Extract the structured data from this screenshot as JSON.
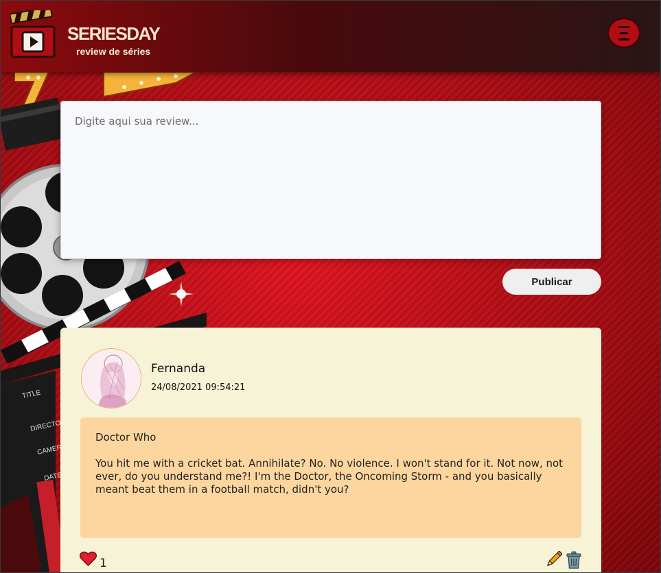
{
  "header": {
    "brand_title": "SERIESDAY",
    "brand_subtitle": "review de séries",
    "logo_icon": "clapperboard-play-icon",
    "menu_icon": "hamburger-menu-icon"
  },
  "composer": {
    "placeholder": "Digite aqui sua review...",
    "value": "",
    "publish_label": "Publicar"
  },
  "posts": [
    {
      "author": "Fernanda",
      "date": "24/08/2021 09:54:21",
      "series": "Doctor Who",
      "text": "You hit me with a cricket bat. Annihilate? No. No violence. I won't stand for it. Not now, not ever, do you understand me?! I'm the Doctor, the Oncoming Storm - and you basically meant beat them in a football match, didn't you?",
      "likes": "1",
      "like_icon": "heart-icon",
      "edit_icon": "pencil-icon",
      "delete_icon": "trash-icon"
    }
  ],
  "decor": {
    "clapper_labels": [
      "TITLE",
      "DIRECTOR",
      "CAMERA",
      "DATE"
    ]
  },
  "colors": {
    "brand_red": "#b00d15",
    "header_dark": "#2a1516",
    "card_bg": "#f7f3d6",
    "post_body_bg": "#fdd69f",
    "brand_text": "#fbe7c9"
  }
}
